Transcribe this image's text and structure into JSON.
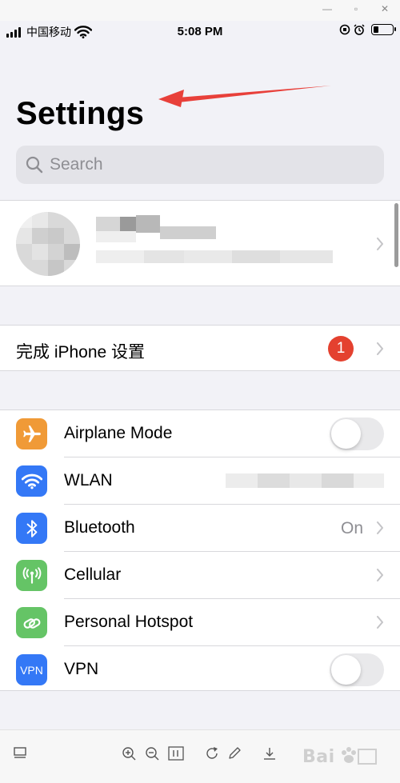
{
  "window": {
    "controls": [
      "minimize-icon",
      "maximize-icon",
      "close-icon"
    ]
  },
  "status_bar": {
    "carrier": "中国移动",
    "time": "5:08 PM",
    "battery_level": 0.25
  },
  "header": {
    "title": "Settings"
  },
  "search": {
    "placeholder": "Search"
  },
  "setup_row": {
    "label": "完成 iPhone 设置",
    "badge": "1"
  },
  "settings_rows": [
    {
      "label": "Airplane Mode",
      "icon": "airplane-icon",
      "color": "#f09a37",
      "control": "toggle",
      "on": false
    },
    {
      "label": "WLAN",
      "icon": "wifi-icon",
      "color": "#3478f6",
      "control": "value",
      "value": ""
    },
    {
      "label": "Bluetooth",
      "icon": "bluetooth-icon",
      "color": "#3478f6",
      "control": "value",
      "value": "On"
    },
    {
      "label": "Cellular",
      "icon": "cellular-antenna-icon",
      "color": "#65c466",
      "control": "chevron"
    },
    {
      "label": "Personal Hotspot",
      "icon": "hotspot-link-icon",
      "color": "#65c466",
      "control": "chevron"
    },
    {
      "label": "VPN",
      "icon": "vpn-icon",
      "color": "#3478f6",
      "control": "toggle",
      "on": false,
      "icon_text": "VPN"
    }
  ],
  "colors": {
    "accent_arrow": "#e8403a",
    "badge": "#e4412f",
    "background": "#f2f2f7"
  }
}
